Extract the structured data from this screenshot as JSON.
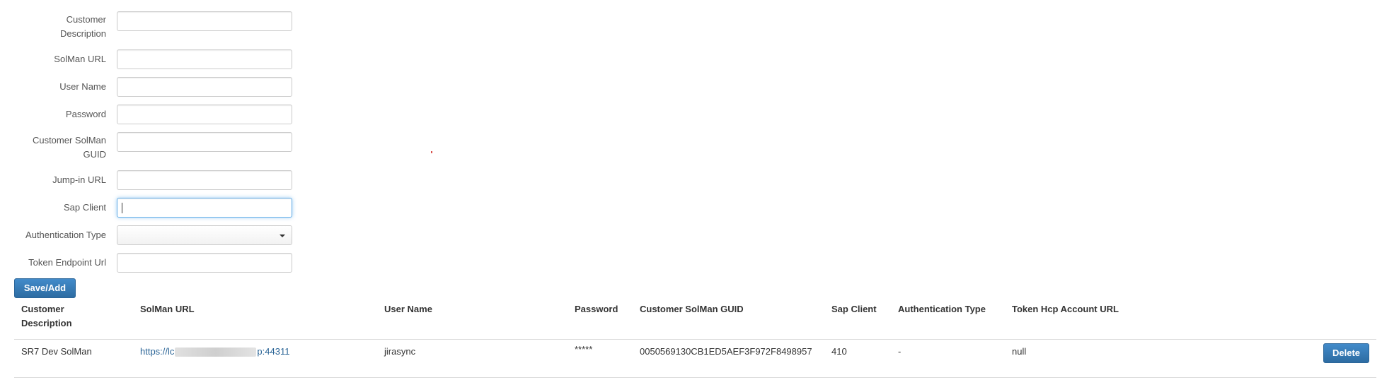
{
  "form": {
    "fields": [
      {
        "label": "Customer Description",
        "value": "",
        "type": "text"
      },
      {
        "label": "SolMan URL",
        "value": "",
        "type": "text"
      },
      {
        "label": "User Name",
        "value": "",
        "type": "text"
      },
      {
        "label": "Password",
        "value": "",
        "type": "password"
      },
      {
        "label": "Customer SolMan GUID",
        "value": "",
        "type": "text"
      },
      {
        "label": "Jump-in URL",
        "value": "",
        "type": "text"
      },
      {
        "label": "Sap Client",
        "value": "",
        "type": "text",
        "focused": true
      },
      {
        "label": "Authentication Type",
        "value": "",
        "type": "select"
      },
      {
        "label": "Token Endpoint Url",
        "value": "",
        "type": "text"
      }
    ],
    "save_label": "Save/Add"
  },
  "table": {
    "headers": [
      "Customer Description",
      "SolMan URL",
      "User Name",
      "Password",
      "Customer SolMan GUID",
      "Sap Client",
      "Authentication Type",
      "Token Hcp Account URL"
    ],
    "rows": [
      {
        "customer_description": "SR7 Dev SolMan",
        "solman_url_prefix": "https://lc",
        "solman_url_suffix": "p:44311",
        "user_name": "jirasync",
        "password": "*****",
        "guid": "0050569130CB1ED5AEF3F972F8498957",
        "sap_client": "410",
        "auth_type": "-",
        "token_url": "null",
        "delete_label": "Delete"
      }
    ]
  },
  "colors": {
    "primary": "#428bca",
    "link": "#2a6496",
    "border": "#cccccc"
  }
}
